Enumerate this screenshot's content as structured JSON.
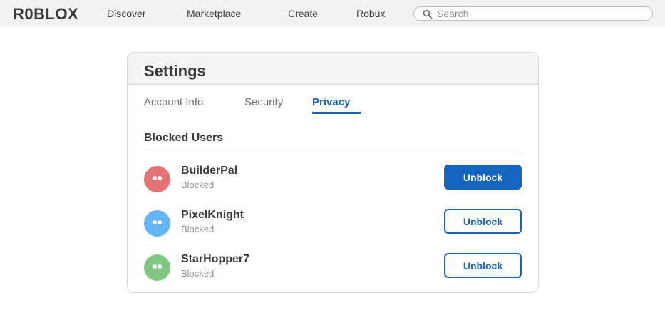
{
  "topbar": {
    "logo": "R0BLOX",
    "nav": [
      "Discover",
      "Marketplace",
      "Create",
      "Robux"
    ],
    "search": {
      "placeholder": "Search",
      "value": ""
    }
  },
  "settings": {
    "title": "Settings",
    "tabs": [
      "Account Info",
      "Security",
      "Privacy"
    ],
    "active_tab": "Privacy",
    "section_title": "Blocked Users",
    "users": [
      {
        "name": "BuilderPal",
        "status": "Blocked",
        "button": "Unblock",
        "avatar_color": "#e57373",
        "button_style": "filled"
      },
      {
        "name": "PixelKnight",
        "status": "Blocked",
        "button": "Unblock",
        "avatar_color": "#64b5f6",
        "button_style": "outline"
      },
      {
        "name": "StarHopper7",
        "status": "Blocked",
        "button": "Unblock",
        "avatar_color": "#81c784",
        "button_style": "outline"
      }
    ]
  },
  "colors": {
    "accent": "#1565c0",
    "topbar_bg": "#f2f2f2"
  }
}
